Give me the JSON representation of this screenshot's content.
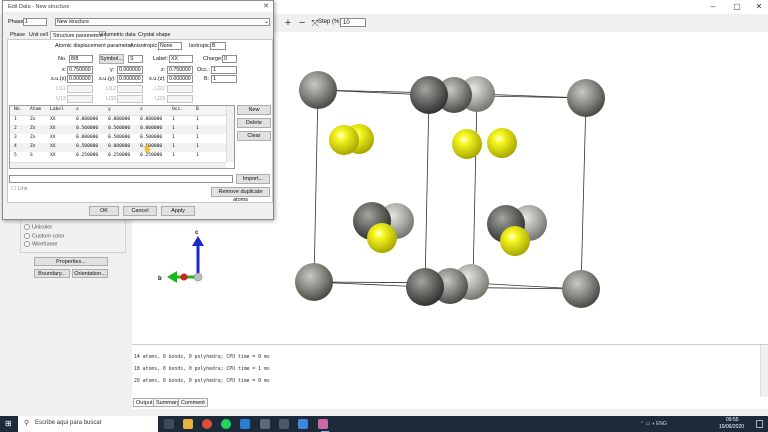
{
  "dialog": {
    "title": "Edit Data - New structure",
    "phase_label": "Phase:",
    "phase_value": "1",
    "structure_name": "New structure",
    "tabs": [
      "Phase",
      "Unit cell",
      "Structure parameters",
      "Volumetric data",
      "Crystal shape"
    ],
    "adp_label": "Atomic displacement parameter",
    "anisotropic_label": "Anisotropic:",
    "anisotropic_value": "None",
    "isotropic_label": "Isotropic:",
    "isotropic_value": "B",
    "no_label": "No.",
    "no_value": "8/8",
    "symbol_button": "Symbol...",
    "symbol_value": "S",
    "label_label": "Label:",
    "label_value": "XX",
    "charge_label": "Charge:",
    "charge_value": "0",
    "x_label": "x:",
    "x_value": "0.750000",
    "y_label": "y:",
    "y_value": "0.000000",
    "z_label": "z:",
    "z_value": "0.750000",
    "occ_label": "Occ.:",
    "occ_value": "1",
    "b_label": "B:",
    "b_value": "1",
    "sx_label": "s.u.(x):",
    "sx_value": "0.000000",
    "sy_label": "s.u.(y):",
    "sy_value": "0.000000",
    "sz_label": "s.u.(z):",
    "sz_value": "0.000000",
    "u11": "U11",
    "u12": "U12",
    "u22": "U22",
    "u13": "U13",
    "u33": "U33",
    "u23": "U23",
    "table_headers": [
      "No.",
      "Atom",
      "Label",
      "x",
      "y",
      "z",
      "Occ.",
      "B"
    ],
    "table_rows": [
      [
        "1",
        "Zn",
        "XX",
        "0.000000",
        "0.000000",
        "0.000000",
        "1",
        "1"
      ],
      [
        "2",
        "Zn",
        "XX",
        "0.500000",
        "0.500000",
        "0.000000",
        "1",
        "1"
      ],
      [
        "3",
        "Zn",
        "XX",
        "0.000000",
        "0.500000",
        "0.500000",
        "1",
        "1"
      ],
      [
        "4",
        "Zn",
        "XX",
        "0.500000",
        "0.000000",
        "0.500000",
        "1",
        "1"
      ],
      [
        "5",
        "S",
        "XX",
        "0.250000",
        "0.250000",
        "0.250000",
        "1",
        "1"
      ]
    ],
    "new_button": "New",
    "delete_button": "Delete",
    "clear_button": "Clear",
    "import_button": "Import...",
    "link_label": "Link",
    "remove_dup_button": "Remove duplicate atoms",
    "ok_button": "OK",
    "cancel_button": "Cancel",
    "apply_button": "Apply"
  },
  "toolbar": {
    "step_label": "Step (%):",
    "step_value": "10"
  },
  "left_panel": {
    "radios": [
      "Unicolor",
      "Custom color",
      "Wireframe"
    ],
    "properties_button": "Properties...",
    "boundary_button": "Boundary...",
    "orientation_button": "Orientation..."
  },
  "axes": {
    "c": "c",
    "b": "b"
  },
  "console": {
    "lines": [
      "14 atoms, 0 bonds, 0 polyhedra; CPU time = 0 ms",
      "18 atoms, 0 bonds, 0 polyhedra; CPU time = 1 ms",
      "20 atoms, 0 bonds, 0 polyhedra; CPU time = 0 ms"
    ],
    "tabs": [
      "Output",
      "Summary",
      "Comment"
    ]
  },
  "taskbar": {
    "search_placeholder": "Escribe aquí para buscar",
    "time": "09:55",
    "date": "19/06/2020"
  },
  "colors": {
    "zn_atom": "#7a7a74",
    "s_atom": "#f2f200",
    "taskbar": "#1c2a3a",
    "axis_c": "#1a28c8",
    "axis_b": "#18b818"
  }
}
